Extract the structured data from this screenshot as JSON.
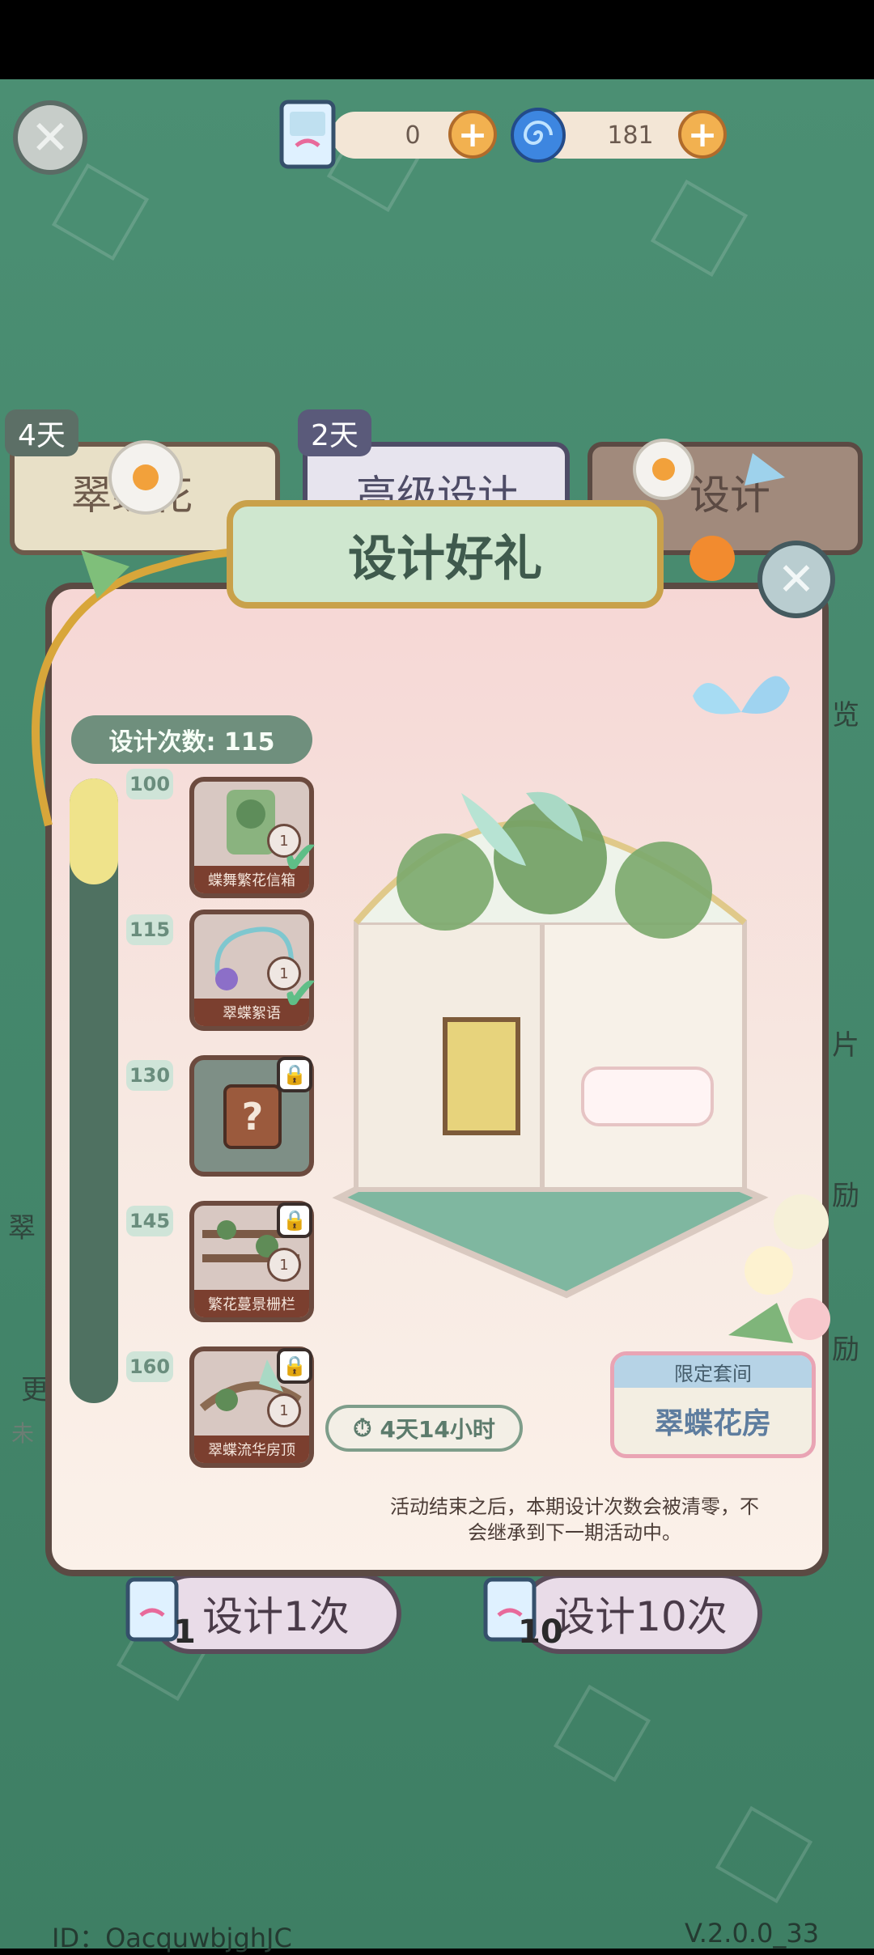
{
  "top_bar": {
    "ticket_count": "0",
    "spiral_count": "181"
  },
  "background_tabs": [
    {
      "days": "4天",
      "label": "翠蝶花"
    },
    {
      "days": "2天",
      "label": "高级设计"
    },
    {
      "label": "设计"
    }
  ],
  "side_hints": [
    "览",
    "片",
    "励",
    "励"
  ],
  "left_hints": [
    "翠",
    "更",
    "未"
  ],
  "modal": {
    "title": "设计好礼",
    "design_count_label": "设计次数: 115",
    "progress_fraction": 0.17,
    "milestones": [
      "100",
      "115",
      "130",
      "145",
      "160"
    ],
    "rewards": [
      {
        "name": "蝶舞繁花信箱",
        "qty": "1",
        "state": "claimed"
      },
      {
        "name": "翠蝶絮语",
        "qty": "1",
        "state": "claimed"
      },
      {
        "name": "",
        "qty": "",
        "state": "locked-mystery"
      },
      {
        "name": "繁花蔓景栅栏",
        "qty": "1",
        "state": "locked"
      },
      {
        "name": "翠蝶流华房顶",
        "qty": "1",
        "state": "locked"
      }
    ],
    "timer": "4天14小时",
    "room_card": {
      "header": "限定套间",
      "name": "翠蝶花房"
    },
    "note_line1": "活动结束之后，本期设计次数会被清零，不",
    "note_line2": "会继承到下一期活动中。"
  },
  "bottom": {
    "design_once_label": "设计1次",
    "design_once_cost": "1",
    "design_ten_label": "设计10次",
    "design_ten_cost": "10"
  },
  "footer": {
    "id_text": "ID：OacquwbjghJC",
    "version": "V.2.0.0_33"
  },
  "colors": {
    "background": "#4b8f73",
    "modal_bg": "#f6d7d5",
    "progress_fill": "#efe38b",
    "accent_orange": "#f2b150"
  },
  "icons": [
    "close-icon",
    "ticket-icon",
    "spiral-icon",
    "plus-icon",
    "check-icon",
    "lock-icon",
    "clock-icon",
    "question-icon"
  ]
}
